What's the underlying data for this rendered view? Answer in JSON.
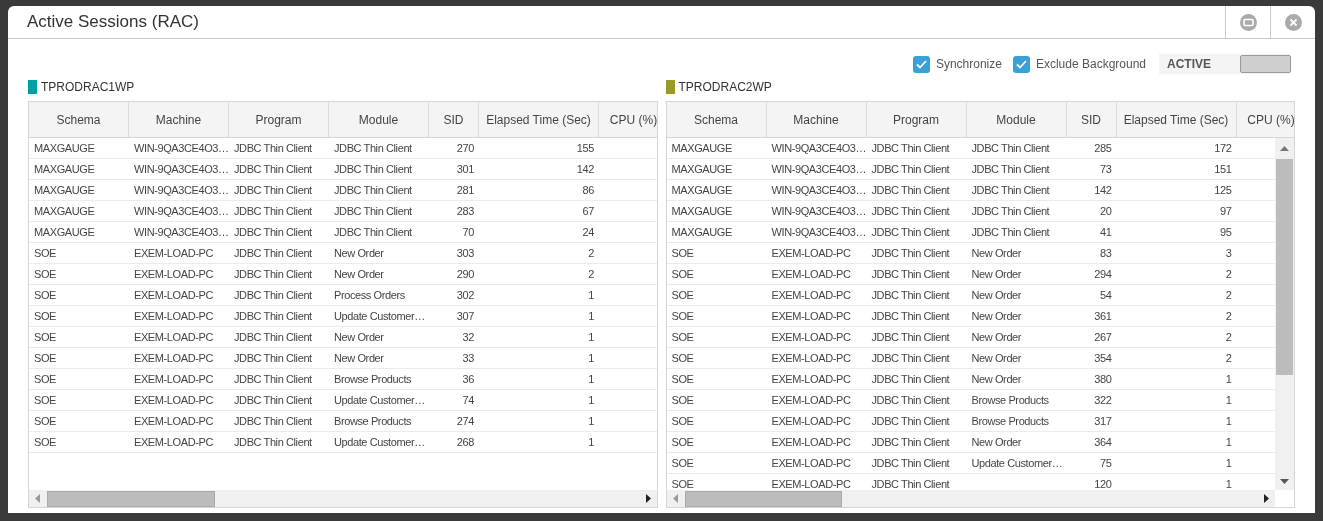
{
  "window": {
    "title": "Active Sessions (RAC)"
  },
  "options": [
    {
      "label": "Synchronize",
      "checked": true
    },
    {
      "label": "Exclude Background",
      "checked": true
    }
  ],
  "mode_switch": {
    "label": "ACTIVE",
    "on": false
  },
  "panels": [
    {
      "name": "TPRODRAC1WP",
      "color": "#00a0a0",
      "columns": [
        {
          "label": "Schema",
          "kind": "text"
        },
        {
          "label": "Machine",
          "kind": "text"
        },
        {
          "label": "Program",
          "kind": "text"
        },
        {
          "label": "Module",
          "kind": "text"
        },
        {
          "label": "SID",
          "kind": "number"
        },
        {
          "label": "Elapsed Time (Sec)",
          "kind": "number"
        },
        {
          "label": "CPU (%)",
          "kind": "number"
        }
      ],
      "rows": [
        [
          "MAXGAUGE",
          "WIN-9QA3CE4O3…",
          "JDBC Thin Client",
          "JDBC Thin Client",
          "270",
          "155"
        ],
        [
          "MAXGAUGE",
          "WIN-9QA3CE4O3…",
          "JDBC Thin Client",
          "JDBC Thin Client",
          "301",
          "142"
        ],
        [
          "MAXGAUGE",
          "WIN-9QA3CE4O3…",
          "JDBC Thin Client",
          "JDBC Thin Client",
          "281",
          "86"
        ],
        [
          "MAXGAUGE",
          "WIN-9QA3CE4O3…",
          "JDBC Thin Client",
          "JDBC Thin Client",
          "283",
          "67"
        ],
        [
          "MAXGAUGE",
          "WIN-9QA3CE4O3…",
          "JDBC Thin Client",
          "JDBC Thin Client",
          "70",
          "24"
        ],
        [
          "SOE",
          "EXEM-LOAD-PC",
          "JDBC Thin Client",
          "New Order",
          "303",
          "2"
        ],
        [
          "SOE",
          "EXEM-LOAD-PC",
          "JDBC Thin Client",
          "New Order",
          "290",
          "2"
        ],
        [
          "SOE",
          "EXEM-LOAD-PC",
          "JDBC Thin Client",
          "Process Orders",
          "302",
          "1"
        ],
        [
          "SOE",
          "EXEM-LOAD-PC",
          "JDBC Thin Client",
          "Update Customer…",
          "307",
          "1"
        ],
        [
          "SOE",
          "EXEM-LOAD-PC",
          "JDBC Thin Client",
          "New Order",
          "32",
          "1"
        ],
        [
          "SOE",
          "EXEM-LOAD-PC",
          "JDBC Thin Client",
          "New Order",
          "33",
          "1"
        ],
        [
          "SOE",
          "EXEM-LOAD-PC",
          "JDBC Thin Client",
          "Browse Products",
          "36",
          "1"
        ],
        [
          "SOE",
          "EXEM-LOAD-PC",
          "JDBC Thin Client",
          "Update Customer…",
          "74",
          "1"
        ],
        [
          "SOE",
          "EXEM-LOAD-PC",
          "JDBC Thin Client",
          "Browse Products",
          "274",
          "1"
        ],
        [
          "SOE",
          "EXEM-LOAD-PC",
          "JDBC Thin Client",
          "Update Customer…",
          "268",
          "1"
        ]
      ]
    },
    {
      "name": "TPRODRAC2WP",
      "color": "#9a9a2a",
      "columns": [
        {
          "label": "Schema",
          "kind": "text"
        },
        {
          "label": "Machine",
          "kind": "text"
        },
        {
          "label": "Program",
          "kind": "text"
        },
        {
          "label": "Module",
          "kind": "text"
        },
        {
          "label": "SID",
          "kind": "number"
        },
        {
          "label": "Elapsed Time (Sec)",
          "kind": "number"
        },
        {
          "label": "CPU (%)",
          "kind": "number"
        }
      ],
      "rows": [
        [
          "MAXGAUGE",
          "WIN-9QA3CE4O3…",
          "JDBC Thin Client",
          "JDBC Thin Client",
          "285",
          "172"
        ],
        [
          "MAXGAUGE",
          "WIN-9QA3CE4O3…",
          "JDBC Thin Client",
          "JDBC Thin Client",
          "73",
          "151"
        ],
        [
          "MAXGAUGE",
          "WIN-9QA3CE4O3…",
          "JDBC Thin Client",
          "JDBC Thin Client",
          "142",
          "125"
        ],
        [
          "MAXGAUGE",
          "WIN-9QA3CE4O3…",
          "JDBC Thin Client",
          "JDBC Thin Client",
          "20",
          "97"
        ],
        [
          "MAXGAUGE",
          "WIN-9QA3CE4O3…",
          "JDBC Thin Client",
          "JDBC Thin Client",
          "41",
          "95"
        ],
        [
          "SOE",
          "EXEM-LOAD-PC",
          "JDBC Thin Client",
          "New Order",
          "83",
          "3"
        ],
        [
          "SOE",
          "EXEM-LOAD-PC",
          "JDBC Thin Client",
          "New Order",
          "294",
          "2"
        ],
        [
          "SOE",
          "EXEM-LOAD-PC",
          "JDBC Thin Client",
          "New Order",
          "54",
          "2"
        ],
        [
          "SOE",
          "EXEM-LOAD-PC",
          "JDBC Thin Client",
          "New Order",
          "361",
          "2"
        ],
        [
          "SOE",
          "EXEM-LOAD-PC",
          "JDBC Thin Client",
          "New Order",
          "267",
          "2"
        ],
        [
          "SOE",
          "EXEM-LOAD-PC",
          "JDBC Thin Client",
          "New Order",
          "354",
          "2"
        ],
        [
          "SOE",
          "EXEM-LOAD-PC",
          "JDBC Thin Client",
          "New Order",
          "380",
          "1"
        ],
        [
          "SOE",
          "EXEM-LOAD-PC",
          "JDBC Thin Client",
          "Browse Products",
          "322",
          "1"
        ],
        [
          "SOE",
          "EXEM-LOAD-PC",
          "JDBC Thin Client",
          "Browse Products",
          "317",
          "1"
        ],
        [
          "SOE",
          "EXEM-LOAD-PC",
          "JDBC Thin Client",
          "New Order",
          "364",
          "1"
        ],
        [
          "SOE",
          "EXEM-LOAD-PC",
          "JDBC Thin Client",
          "Update Customer…",
          "75",
          "1"
        ],
        [
          "SOE",
          "EXEM-LOAD-PC",
          "JDBC Thin Client",
          null,
          "120",
          "1"
        ]
      ]
    }
  ]
}
